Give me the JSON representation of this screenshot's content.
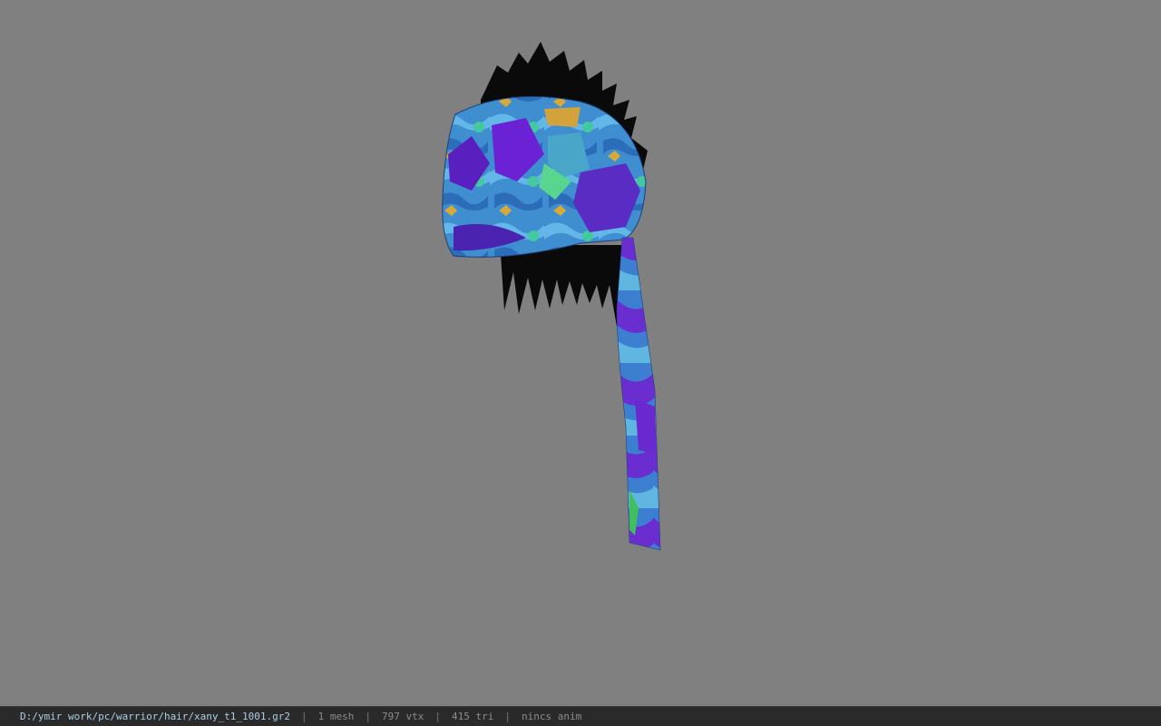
{
  "viewer": {
    "background_color": "#808080",
    "model_icon": "bandana-hair-model"
  },
  "status": {
    "file_path": "D:/ymir work/pc/warrior/hair/xany_t1_1001.gr2",
    "separator": "|",
    "mesh": "1 mesh",
    "vertices": "797 vtx",
    "triangles": "415 tri",
    "anim": "nincs anim"
  },
  "colors": {
    "status_bg": "#2a2a2a",
    "path_text": "#a8cfe6",
    "stat_text": "#8c8c8c"
  }
}
